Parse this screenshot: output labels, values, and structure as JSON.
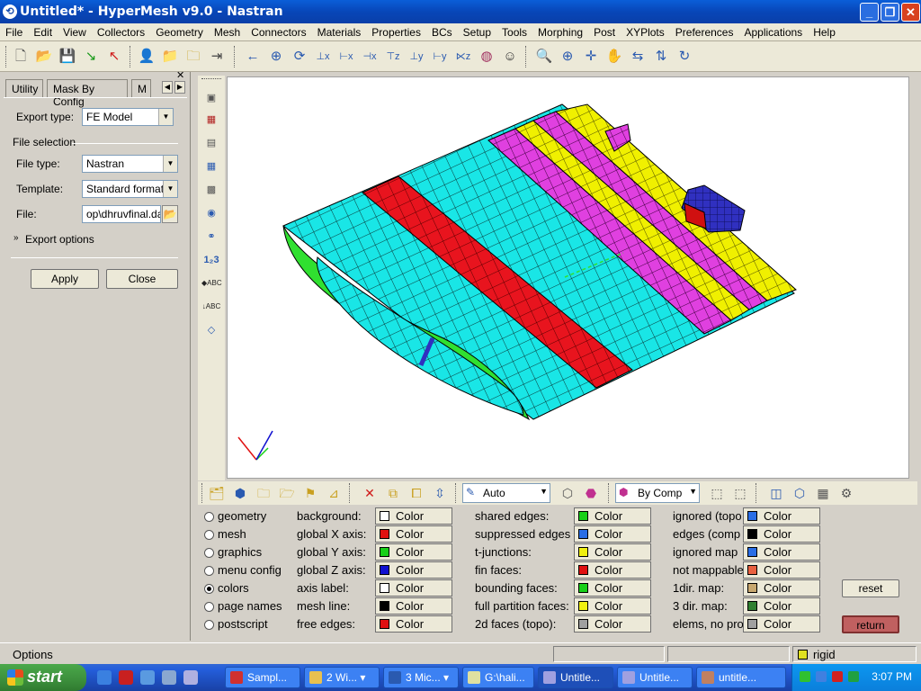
{
  "window": {
    "title": "Untitled* - HyperMesh v9.0 - Nastran"
  },
  "menubar": [
    "File",
    "Edit",
    "View",
    "Collectors",
    "Geometry",
    "Mesh",
    "Connectors",
    "Materials",
    "Properties",
    "BCs",
    "Setup",
    "Tools",
    "Morphing",
    "Post",
    "XYPlots",
    "Preferences",
    "Applications",
    "Help"
  ],
  "left_panel": {
    "tabs": [
      "Utility",
      "Mask By Config",
      "M"
    ],
    "export_type_label": "Export type:",
    "export_type_value": "FE Model",
    "file_selection_label": "File selection",
    "file_type_label": "File type:",
    "file_type_value": "Nastran",
    "template_label": "Template:",
    "template_value": "Standard format",
    "file_label": "File:",
    "file_value": "op\\dhruvfinal.dat",
    "export_options_label": "Export options",
    "apply_label": "Apply",
    "close_label": "Close"
  },
  "bottom_toolbar": {
    "auto_select": "Auto",
    "bycomp_select": "By Comp"
  },
  "options": {
    "radios": [
      {
        "label": "geometry",
        "checked": false
      },
      {
        "label": "mesh",
        "checked": false
      },
      {
        "label": "graphics",
        "checked": false
      },
      {
        "label": "menu config",
        "checked": false
      },
      {
        "label": "colors",
        "checked": true
      },
      {
        "label": "page names",
        "checked": false
      },
      {
        "label": "postscript",
        "checked": false
      }
    ],
    "col1": [
      {
        "label": "background:",
        "color": "#ffffff"
      },
      {
        "label": "global X axis:",
        "color": "#e01010"
      },
      {
        "label": "global Y axis:",
        "color": "#18d018"
      },
      {
        "label": "global Z axis:",
        "color": "#1010d0"
      },
      {
        "label": "axis label:",
        "color": "#ffffff"
      },
      {
        "label": "mesh line:",
        "color": "#000000"
      },
      {
        "label": "free edges:",
        "color": "#e01010"
      }
    ],
    "col2": [
      {
        "label": "shared edges:",
        "color": "#18d018"
      },
      {
        "label": "suppressed edges",
        "color": "#2a6ee6"
      },
      {
        "label": "t-junctions:",
        "color": "#f0f010"
      },
      {
        "label": "fin faces:",
        "color": "#e01010"
      },
      {
        "label": "bounding faces:",
        "color": "#18d018"
      },
      {
        "label": "full partition faces:",
        "color": "#f0f010"
      },
      {
        "label": "2d faces (topo):",
        "color": "#a0a0a0"
      }
    ],
    "col3": [
      {
        "label": "ignored (topo",
        "color": "#2a6ee6"
      },
      {
        "label": "edges (comp",
        "color": "#000000"
      },
      {
        "label": "ignored map",
        "color": "#2a6ee6"
      },
      {
        "label": "not mappable",
        "color": "#e86040"
      },
      {
        "label": "1dir. map:",
        "color": "#c8a870"
      },
      {
        "label": "3 dir. map:",
        "color": "#308030"
      },
      {
        "label": "elems, no pro",
        "color": "#a0a0a0"
      }
    ],
    "color_button_label": "Color",
    "reset_label": "reset",
    "return_label": "return"
  },
  "status": {
    "left": "Options",
    "component": "rigid"
  },
  "taskbar": {
    "start_label": "start",
    "tasks": [
      "Sampl...",
      "2 Wi...",
      "3 Mic...",
      "G:\\hali...",
      "Untitle...",
      "Untitle...",
      "untitle..."
    ],
    "clock": "3:07 PM"
  },
  "colors": {
    "cyan": "#19e6e6",
    "red": "#e8141e",
    "magenta": "#e040e0",
    "yellow": "#f0f000",
    "green": "#30e030",
    "blue": "#3030c0"
  }
}
